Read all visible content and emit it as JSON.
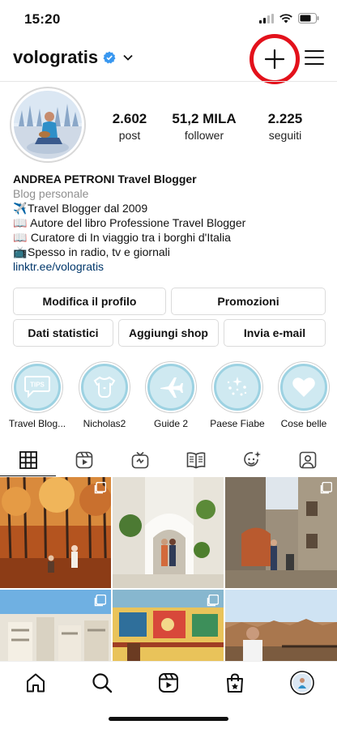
{
  "status_bar": {
    "time": "15:20"
  },
  "header": {
    "username": "vologratis"
  },
  "profile": {
    "stats": [
      {
        "value": "2.602",
        "label": "post"
      },
      {
        "value": "51,2 MILA",
        "label": "follower"
      },
      {
        "value": "2.225",
        "label": "seguiti"
      }
    ],
    "name": "ANDREA PETRONI Travel Blogger",
    "category": "Blog personale",
    "bio_lines": [
      {
        "emoji": "✈️",
        "text": "Travel Blogger dal 2009"
      },
      {
        "emoji": "📖",
        "text": " Autore del libro Professione Travel Blogger"
      },
      {
        "emoji": "📖",
        "text": " Curatore di In viaggio tra i borghi d'Italia"
      },
      {
        "emoji": "📺",
        "text": "Spesso in radio, tv e giornali"
      }
    ],
    "link": "linktr.ee/vologratis"
  },
  "buttons": {
    "edit_profile": "Modifica il profilo",
    "promotions": "Promozioni",
    "insights": "Dati statistici",
    "add_shop": "Aggiungi shop",
    "email": "Invia e-mail"
  },
  "highlights": [
    {
      "label": "Travel Blog...",
      "icon": "tips-speech-bubble-icon",
      "badge": "TIPS"
    },
    {
      "label": "Nicholas2",
      "icon": "baby-bodysuit-icon"
    },
    {
      "label": "Guide 2",
      "icon": "airplane-icon"
    },
    {
      "label": "Paese Fiabe",
      "icon": "sparkle-snow-globe-icon"
    },
    {
      "label": "Cose belle",
      "icon": "heart-icon"
    }
  ],
  "tabs": [
    "grid-icon",
    "reels-icon",
    "igtv-icon",
    "guides-icon",
    "effects-icon",
    "tagged-icon"
  ],
  "grid": [
    {
      "name": "autumn-forest-post",
      "multi": true
    },
    {
      "name": "white-village-couple-post",
      "multi": false
    },
    {
      "name": "stone-alley-post",
      "multi": true
    },
    {
      "name": "seaside-town-post",
      "multi": true
    },
    {
      "name": "painted-houses-post",
      "multi": true
    },
    {
      "name": "city-panorama-post",
      "multi": false
    }
  ],
  "bottom_nav": [
    "home-icon",
    "search-icon",
    "reels-icon",
    "shop-icon",
    "profile-avatar"
  ],
  "colors": {
    "highlight_circle": "#e3111b",
    "verified": "#3897f0",
    "link": "#00376b",
    "highlight_fill": "#cfe9f1"
  }
}
